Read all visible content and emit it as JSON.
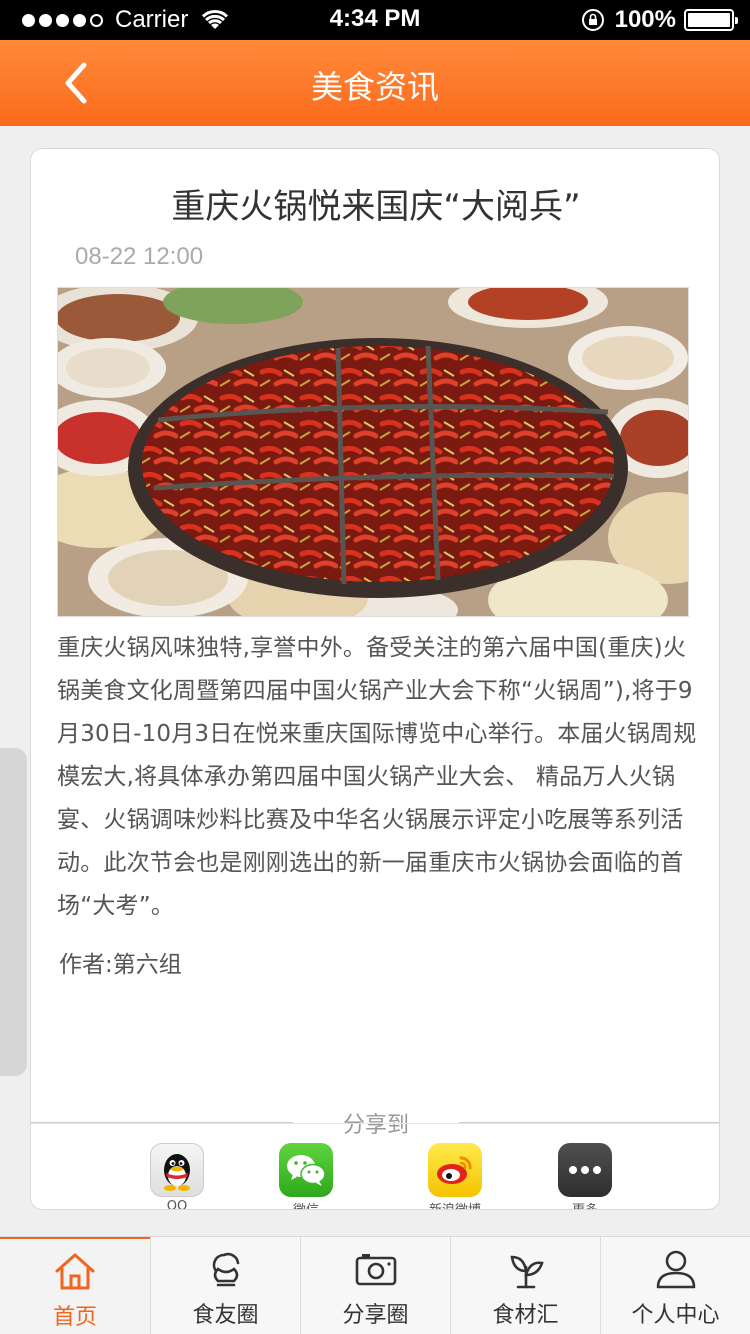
{
  "status_bar": {
    "carrier": "Carrier",
    "time": "4:34 PM",
    "battery": "100%"
  },
  "nav": {
    "title": "美食资讯",
    "back_icon": "chevron-left-icon",
    "accent": "#fb6a1c"
  },
  "article": {
    "title": "重庆火锅悦来国庆“大阅兵”",
    "time": "08-22 12:00",
    "image": "hotpot-photo",
    "body": "重庆火锅风味独特,享誉中外。备受关注的第六届中国(重庆)火锅美食文化周暨第四届中国火锅产业大会下称“火锅周”),将于9月30日-10月3日在悦来重庆国际博览中心举行。本届火锅周规模宏大,将具体承办第四届中国火锅产业大会、 精品万人火锅宴、火锅调味炒料比赛及中华名火锅展示评定小吃展等系列活动。此次节会也是刚刚选出的新一届重庆市火锅协会面临的首场“大考”。",
    "author": "作者:第六组"
  },
  "share": {
    "label": "分享到",
    "items": [
      {
        "name": "QQ",
        "icon": "qq-icon"
      },
      {
        "name": "微信",
        "icon": "wechat-icon"
      },
      {
        "name": "新浪微博",
        "icon": "weibo-icon"
      },
      {
        "name": "更多",
        "icon": "more-icon"
      }
    ]
  },
  "tabs": [
    {
      "label": "首页",
      "icon": "home-icon",
      "active": true
    },
    {
      "label": "食友圈",
      "icon": "chef-hat-icon"
    },
    {
      "label": "分享圈",
      "icon": "camera-icon"
    },
    {
      "label": "食材汇",
      "icon": "sprout-icon"
    },
    {
      "label": "个人中心",
      "icon": "person-icon"
    }
  ],
  "colors": {
    "accent": "#f06522",
    "background": "#efefef"
  }
}
